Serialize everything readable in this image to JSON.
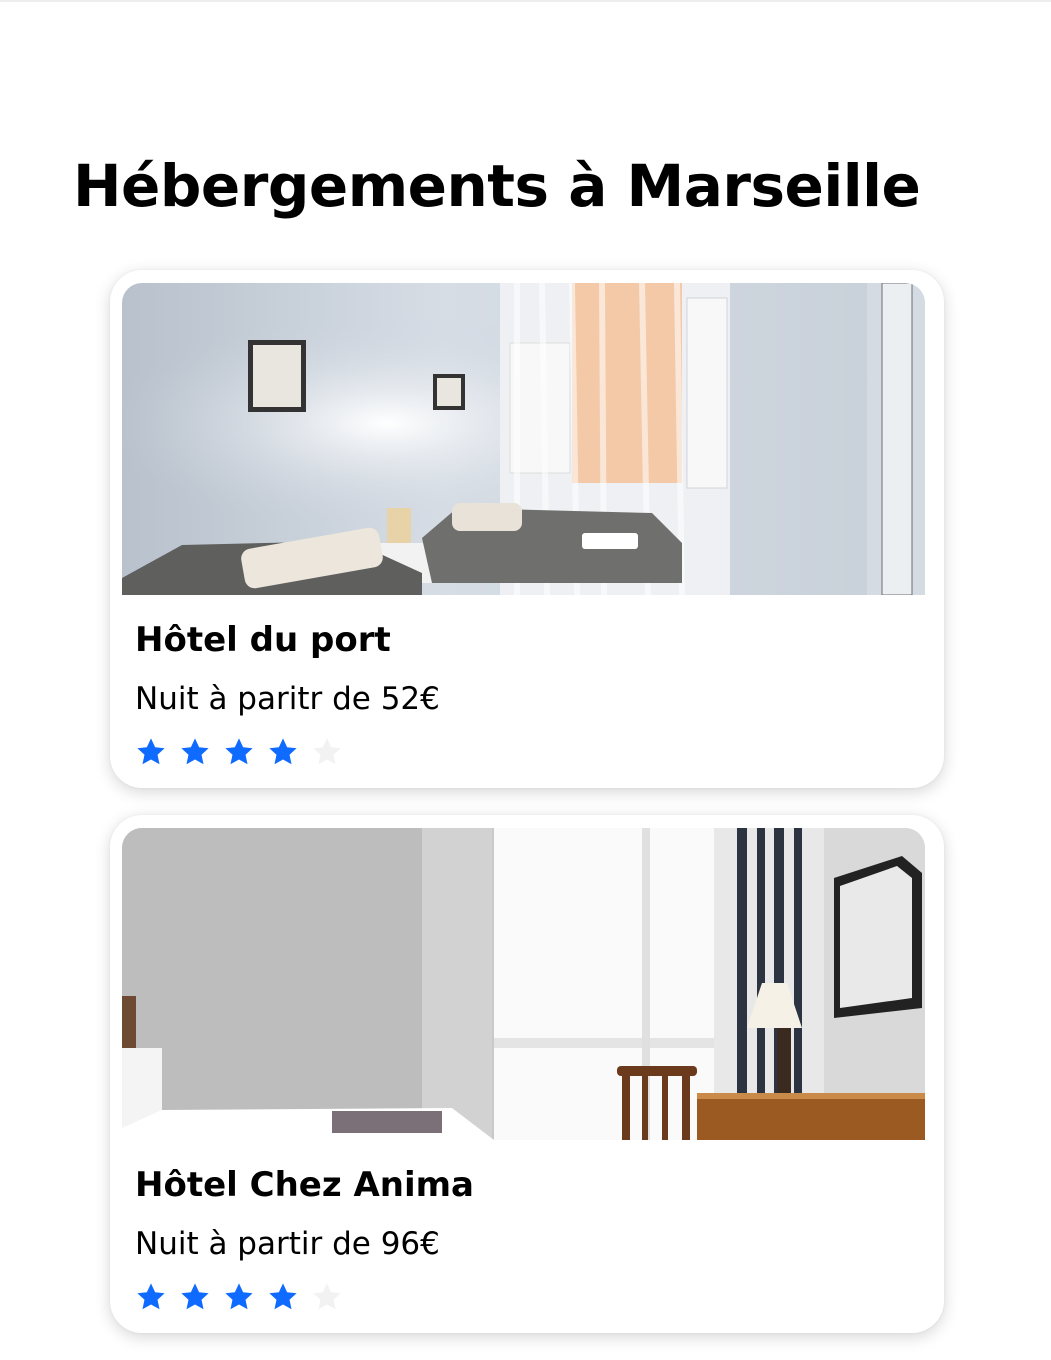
{
  "page": {
    "title": "Hébergements à Marseille"
  },
  "colors": {
    "star_filled": "#0F6BFF",
    "star_empty": "#F2F2F2"
  },
  "listings": [
    {
      "name": "Hôtel du port",
      "price_text": "Nuit à paritr de 52€",
      "rating": 4,
      "rating_max": 5,
      "image": "hotel-room-twin-beds-photo"
    },
    {
      "name": "Hôtel Chez Anima",
      "price_text": "Nuit à partir de 96€",
      "rating": 4,
      "rating_max": 5,
      "image": "hotel-room-desk-window-photo"
    }
  ]
}
